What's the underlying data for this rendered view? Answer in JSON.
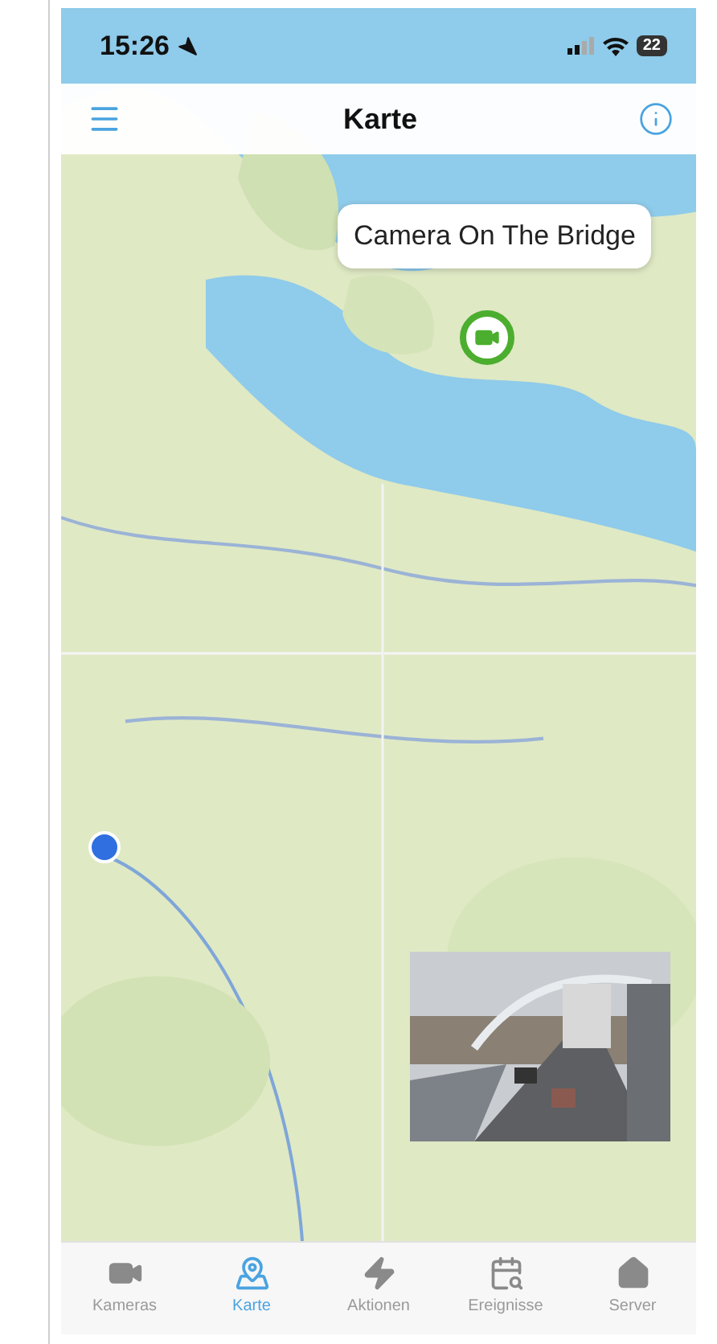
{
  "status_bar": {
    "time": "15:26",
    "battery": "22"
  },
  "nav_bar": {
    "title": "Karte"
  },
  "map": {
    "kind": "picture",
    "callout": "Camera On The Bridge"
  },
  "tabs": [
    {
      "label": "Kameras",
      "selected": false
    },
    {
      "label": "Karte",
      "selected": true
    },
    {
      "label": "Aktionen",
      "selected": false
    },
    {
      "label": "Ereignisse",
      "selected": false
    },
    {
      "label": "Server",
      "selected": false
    }
  ]
}
